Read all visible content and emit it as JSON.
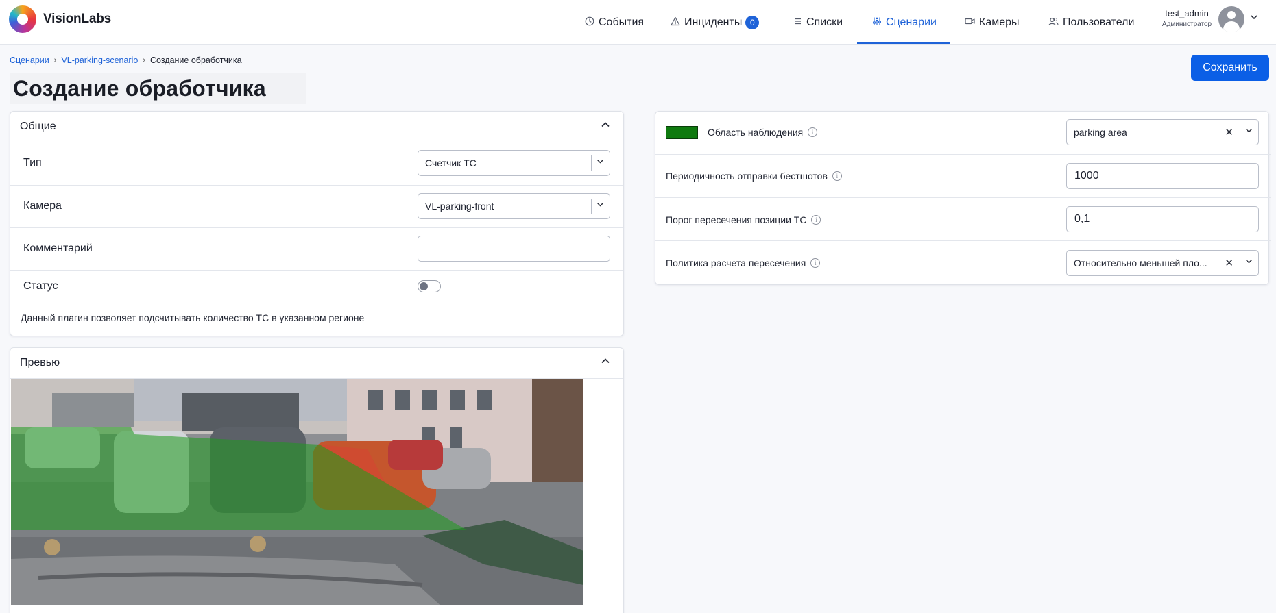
{
  "brand": {
    "name": "VisionLabs"
  },
  "nav": {
    "items": [
      {
        "label": "События",
        "icon": "clock-icon"
      },
      {
        "label": "Инциденты",
        "icon": "warning-icon",
        "badge": "0"
      },
      {
        "label": "Списки",
        "icon": "list-icon"
      },
      {
        "label": "Сценарии",
        "icon": "sliders-icon",
        "active": true
      },
      {
        "label": "Камеры",
        "icon": "camera-icon"
      },
      {
        "label": "Пользователи",
        "icon": "users-icon"
      }
    ],
    "accent": "#1f63d8"
  },
  "user": {
    "name": "test_admin",
    "role": "Администратор"
  },
  "breadcrumb": {
    "items": [
      "Сценарии",
      "VL-parking-scenario"
    ],
    "current": "Создание обработчика"
  },
  "page": {
    "title": "Создание обработчика",
    "save_label": "Сохранить"
  },
  "general": {
    "header": "Общие",
    "type_label": "Тип",
    "type_value": "Счетчик ТС",
    "camera_label": "Камера",
    "camera_value": "VL-parking-front",
    "comment_label": "Комментарий",
    "comment_value": "",
    "status_label": "Статус",
    "status_on": false,
    "description": "Данный плагин позволяет подсчитывать количество ТС в указанном регионе"
  },
  "preview": {
    "header": "Превью"
  },
  "settings": {
    "zone_label": "Область наблюдения",
    "zone_color": "#0f7a0f",
    "zone_value": "parking area",
    "bestshot_label": "Периодичность отправки бестшотов",
    "bestshot_value": "1000",
    "threshold_label": "Порог пересечения позиции ТС",
    "threshold_value": "0,1",
    "policy_label": "Политика расчета пересечения",
    "policy_value": "Относительно меньшей пло..."
  }
}
